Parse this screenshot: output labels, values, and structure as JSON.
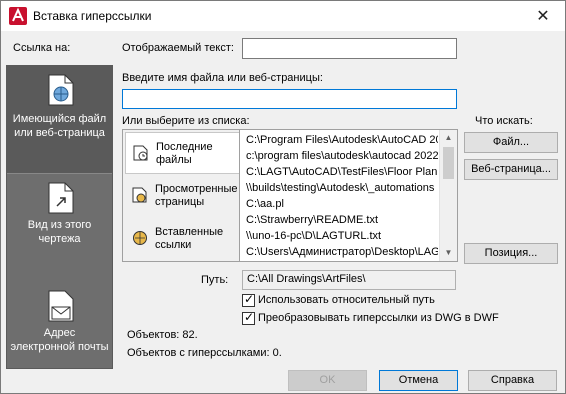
{
  "window": {
    "title": "Вставка гиперссылки",
    "close_symbol": "✕",
    "brand_color": "#c8102e"
  },
  "link_to_label": "Ссылка на:",
  "sidebar": {
    "items": [
      {
        "label_1": "Имеющийся файл",
        "label_2": "или веб-страница",
        "icon": "file-globe-icon",
        "active": true
      },
      {
        "label_1": "Вид из этого",
        "label_2": "чертежа",
        "icon": "drawing-view-icon",
        "active": false
      },
      {
        "label_1": "Адрес",
        "label_2": "электронной почты",
        "icon": "mail-icon",
        "active": false
      }
    ]
  },
  "display_text": {
    "label": "Отображаемый текст:",
    "value": ""
  },
  "filename": {
    "label": "Введите имя файла или веб-страницы:",
    "value": ""
  },
  "choose_label": "Или выберите из списка:",
  "list_tabs": [
    {
      "label_1": "Последние",
      "label_2": "файлы",
      "icon": "recent-files-icon",
      "active": true
    },
    {
      "label_1": "Просмотренные",
      "label_2": "страницы",
      "icon": "browsed-pages-icon",
      "active": false
    },
    {
      "label_1": "Вставленные",
      "label_2": "ссылки",
      "icon": "inserted-links-icon",
      "active": false
    }
  ],
  "list_rows": [
    "C:\\Program Files\\Autodesk\\AutoCAD 20",
    "c:\\program files\\autodesk\\autocad 2022",
    "C:\\LAGT\\AutoCAD\\TestFiles\\Floor Plan S",
    "\\\\builds\\testing\\Autodesk\\_automations",
    "C:\\aa.pl",
    "C:\\Strawberry\\README.txt",
    "\\\\uno-16-pc\\D\\LAGTURL.txt",
    "C:\\Users\\Администратор\\Desktop\\LAG"
  ],
  "browse_for": {
    "label": "Что искать:",
    "file_button": "Файл...",
    "web_button": "Веб-страница..."
  },
  "position_button": "Позиция...",
  "path": {
    "label": "Путь:",
    "value": "C:\\All Drawings\\ArtFiles\\"
  },
  "options": {
    "relative_path": {
      "label": "Использовать относительный путь",
      "checked": true
    },
    "convert_dwf": {
      "label": "Преобразовывать гиперссылки из DWG в DWF",
      "checked": true
    }
  },
  "stats": {
    "objects": "Объектов: 82.",
    "objects_with_links": "Объектов с гиперссылками: 0."
  },
  "footer": {
    "ok": "OK",
    "cancel": "Отмена",
    "help": "Справка"
  }
}
